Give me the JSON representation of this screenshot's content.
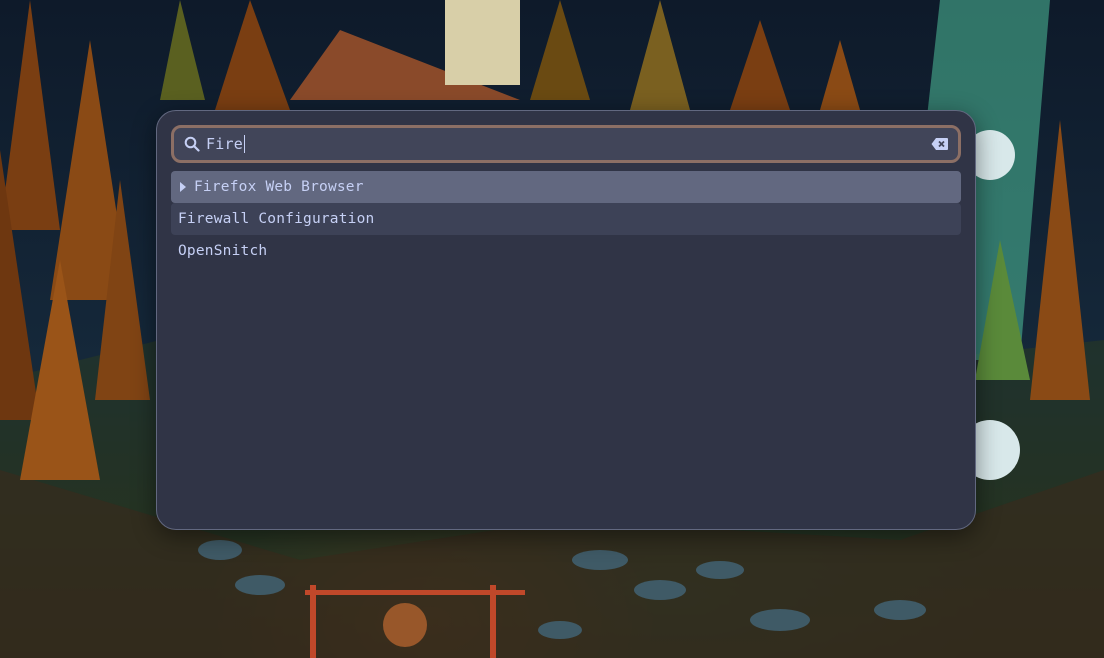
{
  "launcher": {
    "search": {
      "value": "Fire",
      "icon": "search-icon",
      "clear_icon": "clear-text-icon"
    },
    "results": [
      {
        "label": "Firefox Web Browser",
        "state": "selected",
        "expandable": true
      },
      {
        "label": "Firewall Configuration",
        "state": "hovered",
        "expandable": false
      },
      {
        "label": "OpenSnitch",
        "state": "normal",
        "expandable": false
      }
    ]
  },
  "colors": {
    "panel_background": "#303446",
    "search_border": "#8c6f65",
    "selected_background": "#626880",
    "text": "#c6d0f5"
  }
}
